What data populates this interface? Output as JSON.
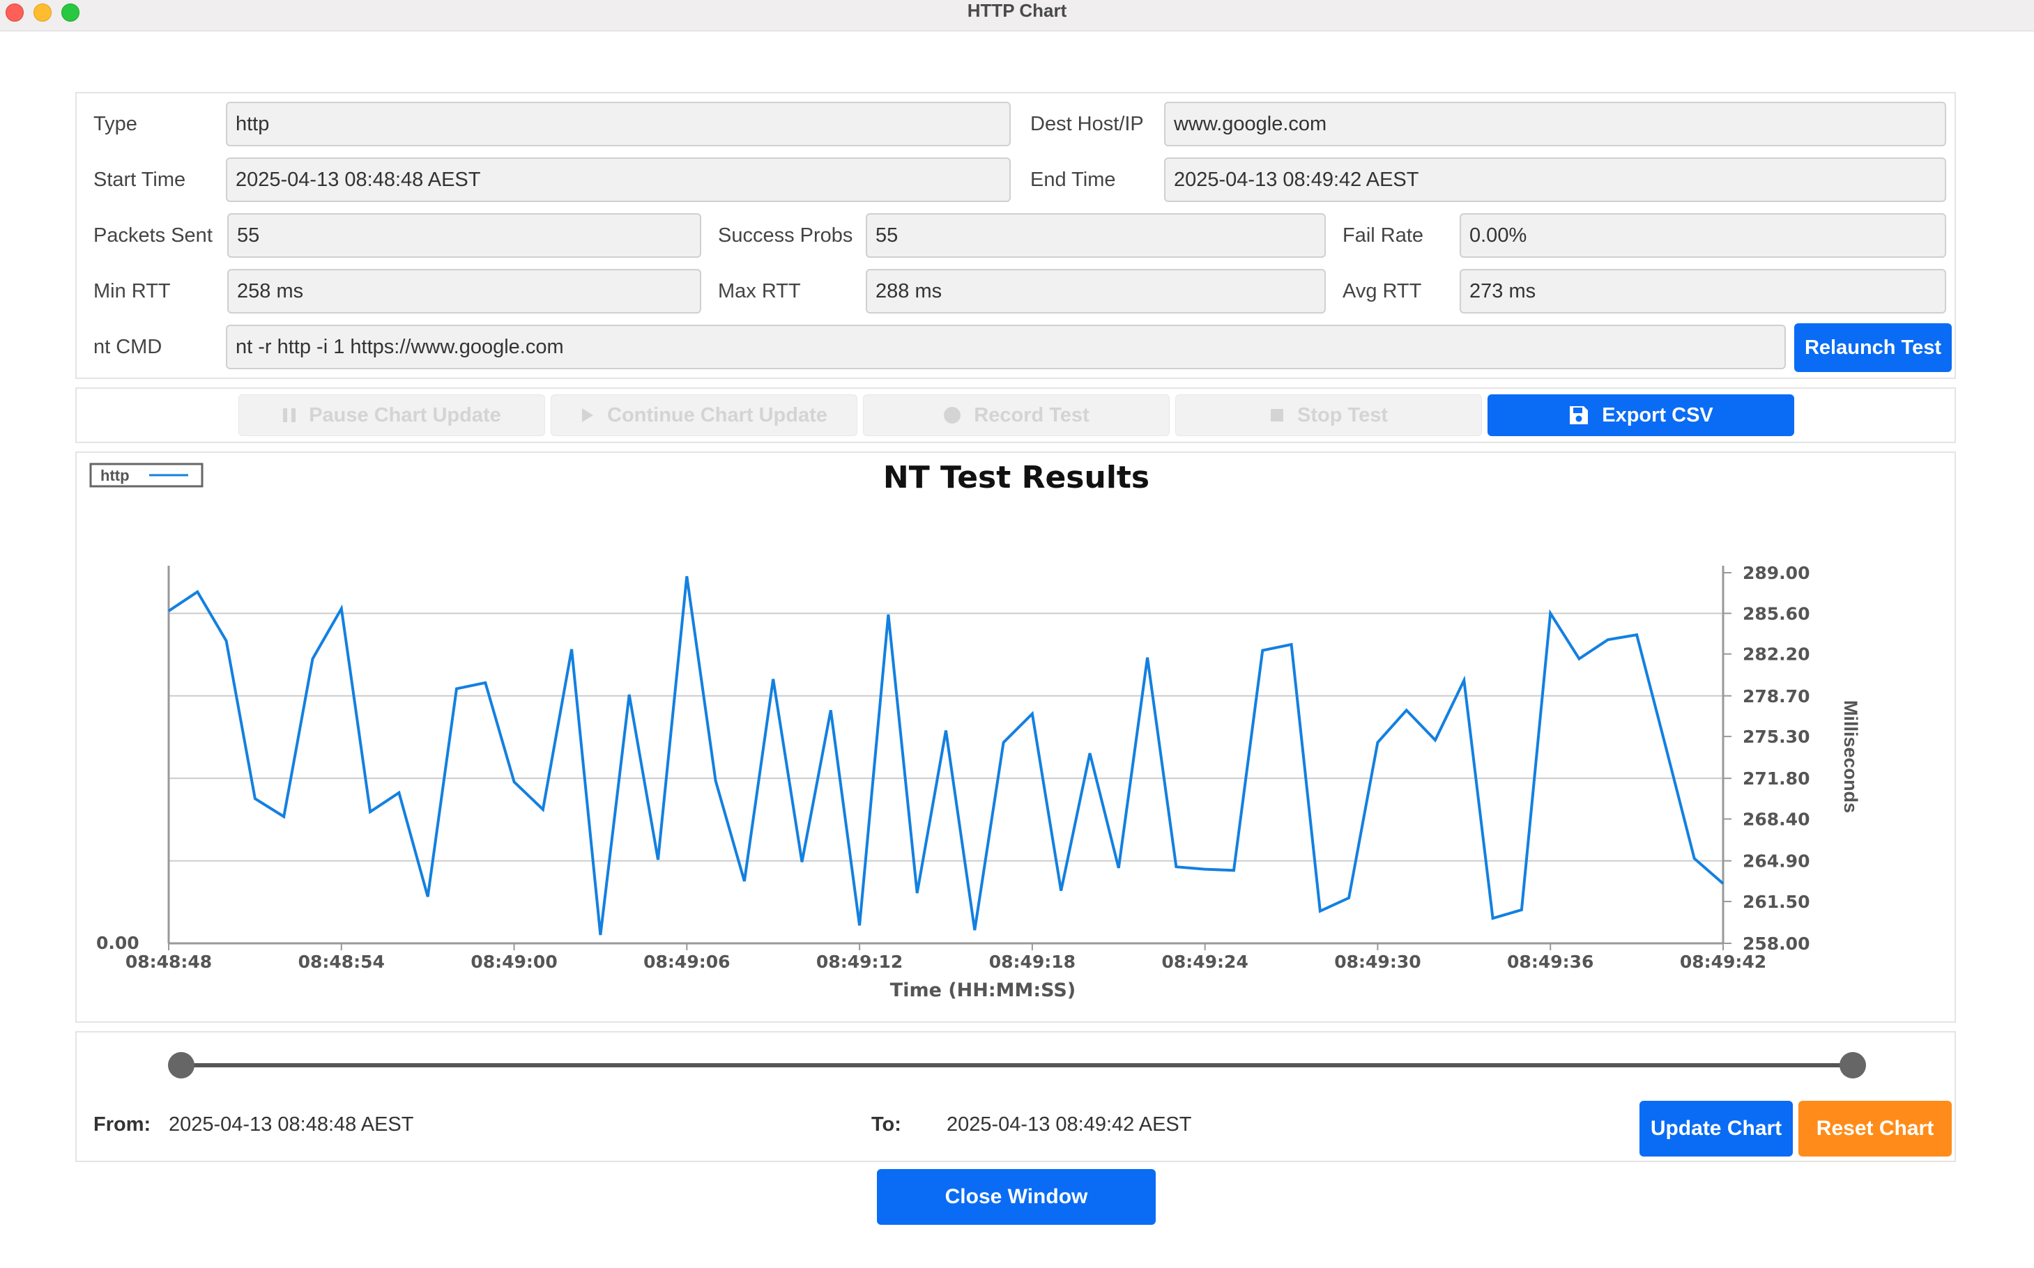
{
  "window": {
    "title": "HTTP Chart"
  },
  "info": {
    "type_label": "Type",
    "type_value": "http",
    "dest_label": "Dest Host/IP",
    "dest_value": "www.google.com",
    "start_label": "Start Time",
    "start_value": "2025-04-13 08:48:48 AEST",
    "end_label": "End Time",
    "end_value": "2025-04-13 08:49:42 AEST",
    "packets_label": "Packets Sent",
    "packets_value": "55",
    "success_label": "Success Probs",
    "success_value": "55",
    "fail_label": "Fail Rate",
    "fail_value": "0.00%",
    "minrtt_label": "Min RTT",
    "minrtt_value": "258 ms",
    "maxrtt_label": "Max RTT",
    "maxrtt_value": "288 ms",
    "avgrtt_label": "Avg RTT",
    "avgrtt_value": "273 ms",
    "cmd_label": "nt CMD",
    "cmd_value": "nt -r http -i 1 https://www.google.com",
    "relaunch_label": "Relaunch Test"
  },
  "actions": {
    "pause_label": "Pause Chart Update",
    "continue_label": "Continue Chart Update",
    "record_label": "Record Test",
    "stop_label": "Stop Test",
    "export_label": "Export CSV"
  },
  "chart_data": {
    "type": "line",
    "title": "NT Test Results",
    "xlabel": "Time (HH:MM:SS)",
    "ylabel": "Milliseconds",
    "legend": {
      "entries": [
        "http"
      ],
      "position": "top-left"
    },
    "y_ticks": [
      "289.00",
      "285.60",
      "282.20",
      "278.70",
      "275.30",
      "271.80",
      "268.40",
      "264.90",
      "261.50",
      "258.00"
    ],
    "y_left_label": "0.00",
    "ylim": [
      258.0,
      289.0
    ],
    "x_ticks": [
      "08:48:48",
      "08:48:54",
      "08:49:00",
      "08:49:06",
      "08:49:12",
      "08:49:18",
      "08:49:24",
      "08:49:30",
      "08:49:36",
      "08:49:42"
    ],
    "grid": "horizontal",
    "line_color": "#1380e0",
    "series": [
      {
        "name": "http",
        "x": [
          "08:48:48",
          "08:48:49",
          "08:48:50",
          "08:48:51",
          "08:48:52",
          "08:48:53",
          "08:48:54",
          "08:48:55",
          "08:48:56",
          "08:48:57",
          "08:48:58",
          "08:48:59",
          "08:49:00",
          "08:49:01",
          "08:49:02",
          "08:49:03",
          "08:49:04",
          "08:49:05",
          "08:49:06",
          "08:49:07",
          "08:49:08",
          "08:49:09",
          "08:49:10",
          "08:49:11",
          "08:49:12",
          "08:49:13",
          "08:49:14",
          "08:49:15",
          "08:49:16",
          "08:49:17",
          "08:49:18",
          "08:49:19",
          "08:49:20",
          "08:49:21",
          "08:49:22",
          "08:49:23",
          "08:49:24",
          "08:49:25",
          "08:49:26",
          "08:49:27",
          "08:49:28",
          "08:49:29",
          "08:49:30",
          "08:49:31",
          "08:49:32",
          "08:49:33",
          "08:49:34",
          "08:49:35",
          "08:49:36",
          "08:49:37",
          "08:49:38",
          "08:49:39",
          "08:49:40",
          "08:49:41",
          "08:49:42"
        ],
        "values": [
          285.8,
          287.4,
          283.3,
          270.1,
          268.6,
          281.8,
          286.0,
          269.0,
          270.6,
          261.9,
          279.3,
          279.8,
          271.5,
          269.2,
          282.6,
          258.7,
          278.8,
          265.0,
          288.7,
          271.6,
          263.2,
          280.1,
          264.8,
          277.5,
          259.5,
          285.5,
          262.2,
          275.8,
          259.1,
          274.8,
          277.2,
          262.4,
          273.9,
          264.3,
          281.9,
          264.4,
          264.2,
          264.1,
          282.5,
          283.0,
          260.7,
          261.8,
          274.8,
          277.5,
          275.0,
          280.0,
          260.1,
          260.8,
          285.6,
          281.8,
          283.4,
          283.8,
          274.5,
          265.1,
          263.0
        ]
      }
    ]
  },
  "range": {
    "from_label": "From:",
    "from_value": "2025-04-13 08:48:48 AEST",
    "to_label": "To:",
    "to_value": "2025-04-13 08:49:42 AEST",
    "update_label": "Update Chart",
    "reset_label": "Reset Chart",
    "start_fraction": 0.0,
    "end_fraction": 1.0
  },
  "footer": {
    "close_label": "Close Window"
  }
}
